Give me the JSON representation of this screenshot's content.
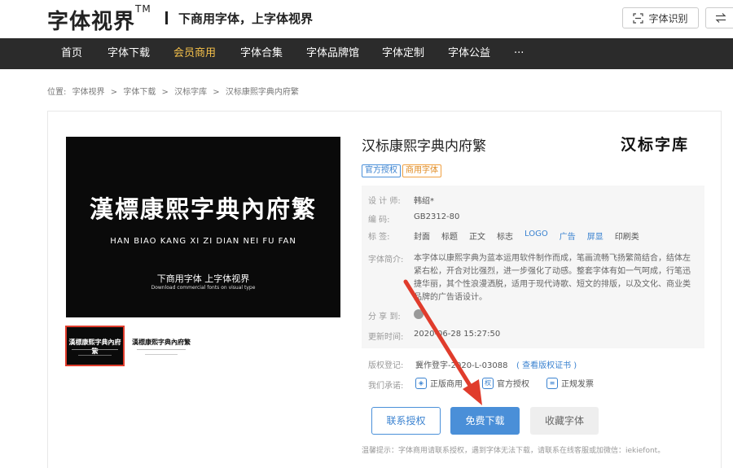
{
  "header": {
    "logo": "字体视界",
    "logo_tm": "TM",
    "slogan": "下商用字体，上字体视界",
    "recognize_label": "字体识别",
    "recognize_icon": "scan-icon",
    "switch_icon": "swap-icon"
  },
  "nav": {
    "items": [
      {
        "label": "首页"
      },
      {
        "label": "字体下载"
      },
      {
        "label": "会员商用"
      },
      {
        "label": "字体合集"
      },
      {
        "label": "字体品牌馆"
      },
      {
        "label": "字体定制"
      },
      {
        "label": "字体公益"
      },
      {
        "label": "···"
      }
    ],
    "active_index": 2
  },
  "breadcrumb": {
    "items": [
      "位置:",
      "字体视界",
      ">",
      "字体下载",
      ">",
      "汉标字库",
      ">",
      "汉标康熙字典内府繁"
    ]
  },
  "preview": {
    "title": "漢標康熙字典內府繁",
    "pinyin": "HAN BIAO KANG XI ZI DIAN NEI FU FAN",
    "subtitle": "下商用字体 上字体视界",
    "subtitle_en": "Download commercial fonts on visual type",
    "thumb1_text": "漢標康熙字典內府繁",
    "thumb2_text": "漢標康熙字典內府繁"
  },
  "font": {
    "name": "汉标康熙字典内府繁",
    "brand": "汉标字库",
    "tags": [
      "官方授权",
      "商用字体"
    ],
    "designer_label": "设 计 师:",
    "designer": "韩绍*",
    "code_label": "编 码:",
    "code": "GB2312-80",
    "labels_label": "标 签:",
    "labels": [
      "封面",
      "标题",
      "正文",
      "标志",
      "LOGO",
      "广告",
      "屏显",
      "印刷类"
    ],
    "desc_label": "字体简介:",
    "description": "本字体以康熙字典为蓝本运用软件制作而成，笔画流畅飞扬繁简结合，结体左紧右松，开合对比强烈，进一步强化了动感。整套字体有如一气呵成，行笔迅捷华丽，其个性浪漫洒脱，适用于现代诗歌、短文的排版，以及文化、商业类品牌的广告语设计。",
    "share_label": "分 享 到:",
    "update_label": "更新时间:",
    "update_time": "2020-06-28 15:27:50",
    "copyright_label": "版权登记:",
    "copyright_value": "冀作登字-2020-L-03088",
    "copyright_link": "( 查看版权证书 )",
    "promise_label": "我们承诺:",
    "promises": [
      {
        "icon": "shield-icon",
        "label": "正版商用"
      },
      {
        "icon": "certificate-icon",
        "label": "官方授权"
      },
      {
        "icon": "invoice-icon",
        "label": "正规发票"
      }
    ]
  },
  "buttons": {
    "contact": "联系授权",
    "download": "免费下载",
    "collect": "收藏字体"
  },
  "tip": "温馨提示：字体商用请联系授权，遇到字体无法下载，请联系在线客服或加微信：iekiefont。",
  "colors": {
    "nav_bg": "#2b2b2b",
    "nav_active": "#f5c04a",
    "accent_blue": "#4a8fd8",
    "annotation_red": "#e03c2c"
  }
}
